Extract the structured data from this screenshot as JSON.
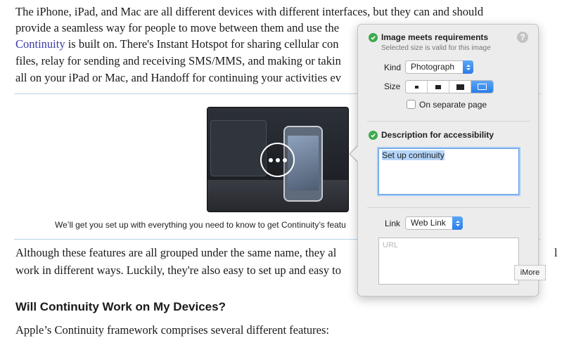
{
  "article": {
    "lines_top": [
      "The iPhone, iPad, and Mac are all different devices with different interfaces, but they can and should",
      "provide a seamless way for people to move between them and use the"
    ],
    "line3_link": "Continuity",
    "line3_rest": " is built on. There's Instant Hotspot for sharing cellular con",
    "lines_mid": [
      "files, relay for sending and receiving SMS/MMS, and making or takin",
      "all on your iPad or Mac, and Handoff for continuing your activities ev"
    ],
    "caption": "We’ll get you set up with everything you need to know to get Continuity’s featu",
    "lines_after": [
      "Although these features are all grouped under the same name, they al",
      "work in different ways. Luckily, they're also easy to set up and easy to"
    ],
    "right_edge_fragment": "l",
    "heading": "Will Continuity Work on My Devices?",
    "last_line": "Apple’s Continuity framework comprises several different features:"
  },
  "popover": {
    "requirements_title": "Image meets requirements",
    "requirements_subtitle": "Selected size is valid for this image",
    "help_label": "?",
    "kind_label": "Kind",
    "kind_value": "Photograph",
    "size_label": "Size",
    "size_options": [
      "small",
      "medium",
      "large",
      "full"
    ],
    "size_selected": "full",
    "separate_page_label": "On separate page",
    "separate_page_checked": false,
    "accessibility_title": "Description for accessibility",
    "description_value": "Set up continuity",
    "link_label": "Link",
    "link_value": "Web Link",
    "url_placeholder": "URL"
  },
  "tooltip": "iMore",
  "colors": {
    "accent": "#2b7de9",
    "success": "#3daa4c",
    "link": "#3a3aa8"
  }
}
